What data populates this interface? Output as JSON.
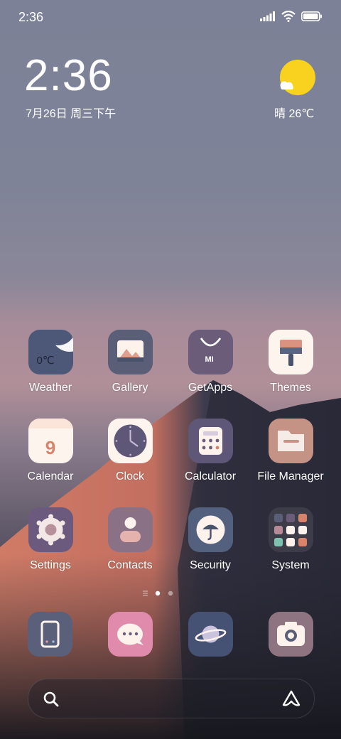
{
  "status_bar": {
    "time": "2:36",
    "icons": [
      "signal-icon",
      "wifi-icon",
      "battery-icon"
    ]
  },
  "clock_widget": {
    "time": "2:36",
    "date": "7月26日 周三下午"
  },
  "weather_widget": {
    "text": "晴 26℃",
    "icon": "sunny-cloud-icon"
  },
  "apps": [
    {
      "label": "Weather",
      "icon": "weather-icon",
      "badge": "0℃"
    },
    {
      "label": "Gallery",
      "icon": "gallery-icon"
    },
    {
      "label": "GetApps",
      "icon": "getapps-icon",
      "badge": "MI"
    },
    {
      "label": "Themes",
      "icon": "themes-icon"
    },
    {
      "label": "Calendar",
      "icon": "calendar-icon",
      "badge": "9"
    },
    {
      "label": "Clock",
      "icon": "clock-icon"
    },
    {
      "label": "Calculator",
      "icon": "calculator-icon"
    },
    {
      "label": "File Manager",
      "icon": "folder-icon"
    },
    {
      "label": "Settings",
      "icon": "gear-icon"
    },
    {
      "label": "Contacts",
      "icon": "contacts-icon"
    },
    {
      "label": "Security",
      "icon": "umbrella-icon"
    },
    {
      "label": "System",
      "icon": "folder-grid-icon"
    }
  ],
  "page_indicator": {
    "pages": 2,
    "current": 1
  },
  "dock": [
    {
      "icon": "phone-icon"
    },
    {
      "icon": "messages-icon"
    },
    {
      "icon": "browser-icon"
    },
    {
      "icon": "camera-icon"
    }
  ],
  "search_bar": {
    "left_icon": "search-icon",
    "right_icon": "assistant-icon"
  },
  "colors": {
    "sun": "#f9d21f",
    "weather_bg": "#4a5575",
    "gallery_bg": "#5b5e77",
    "getapps_bg": "#6b5c79",
    "themes_bg": "#fdf4ee",
    "calendar_bg": "#fdf4ee",
    "clock_bg": "#fdf4ee",
    "calc_bg": "#5f5777",
    "files_bg": "#c49385",
    "settings_bg": "#6b5a7d",
    "contacts_bg": "#8a7186",
    "security_bg": "#54617e",
    "system_bg": "#3d3d4a"
  }
}
